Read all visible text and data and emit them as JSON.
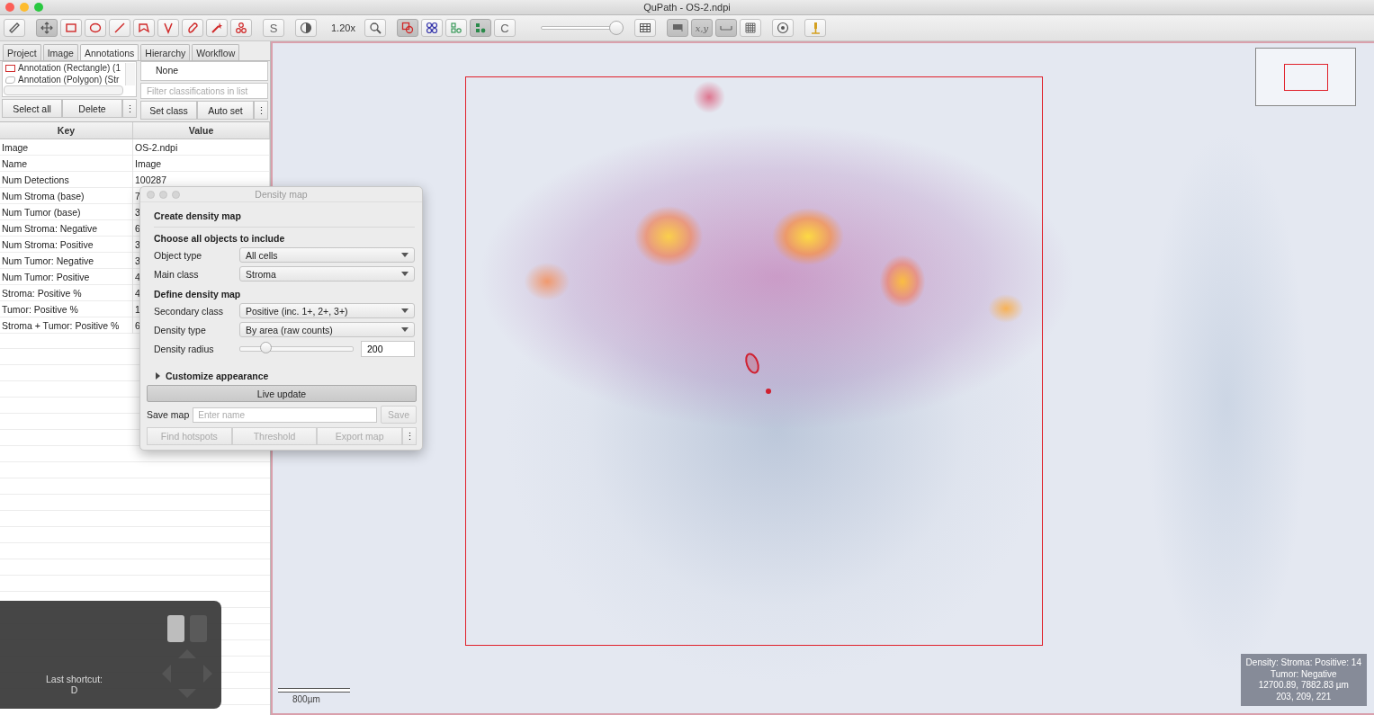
{
  "window": {
    "title": "QuPath - OS-2.ndpi"
  },
  "toolbar": [
    {
      "kind": "icon",
      "selected": false
    },
    {
      "kind": "icon",
      "selected": true
    },
    {
      "kind": "icon",
      "selected": false
    },
    {
      "kind": "icon",
      "selected": false
    },
    {
      "kind": "icon",
      "selected": false
    },
    {
      "kind": "icon",
      "selected": false
    },
    {
      "kind": "icon",
      "selected": false
    },
    {
      "kind": "icon",
      "selected": false
    },
    {
      "kind": "icon",
      "selected": false
    },
    {
      "kind": "icon",
      "selected": false
    },
    {
      "kind": "text",
      "label": "S",
      "selected": false
    },
    {
      "kind": "icon",
      "selected": false
    },
    {
      "kind": "zoom",
      "label": "1.20x"
    },
    {
      "kind": "icon",
      "selected": false
    },
    {
      "kind": "icon",
      "selected": true
    },
    {
      "kind": "icon",
      "selected": false
    },
    {
      "kind": "icon",
      "selected": false
    },
    {
      "kind": "icon",
      "selected": true
    },
    {
      "kind": "text",
      "label": "C",
      "selected": false
    },
    {
      "kind": "slider",
      "level": 0.95
    },
    {
      "kind": "icon",
      "selected": false
    },
    {
      "kind": "icon",
      "selected": true
    },
    {
      "kind": "text",
      "label": "x,y",
      "selected": true
    },
    {
      "kind": "icon",
      "selected": true
    },
    {
      "kind": "icon",
      "selected": false
    },
    {
      "kind": "icon",
      "selected": false
    },
    {
      "kind": "icon",
      "selected": false
    }
  ],
  "tabs": [
    {
      "label": "Project",
      "selected": false
    },
    {
      "label": "Image",
      "selected": false
    },
    {
      "label": "Annotations",
      "selected": true
    },
    {
      "label": "Hierarchy",
      "selected": false
    },
    {
      "label": "Workflow",
      "selected": false
    }
  ],
  "annotations": [
    {
      "label": "Annotation (Rectangle) (1",
      "color": "#d03030"
    },
    {
      "label": "Annotation (Polygon) (Str",
      "color": "#b8b8b8"
    }
  ],
  "classes": [
    {
      "label": "None",
      "selected": false
    }
  ],
  "class_filter": {
    "placeholder": "Filter classifications in list"
  },
  "annotation_buttons": [
    "Select all",
    "Delete",
    "⋮"
  ],
  "class_buttons": [
    "Set class",
    "Auto set",
    "⋮"
  ],
  "measurements": {
    "columns": [
      "Key",
      "Value"
    ],
    "rows": [
      [
        "Image",
        "OS-2.ndpi"
      ],
      [
        "Name",
        "Image"
      ],
      [
        "Num Detections",
        "100287"
      ],
      [
        "Num Stroma (base)",
        "7"
      ],
      [
        "Num Tumor (base)",
        "3"
      ],
      [
        "Num Stroma: Negative",
        "6"
      ],
      [
        "Num Stroma: Positive",
        "3"
      ],
      [
        "Num Tumor: Negative",
        "3"
      ],
      [
        "Num Tumor: Positive",
        "4"
      ],
      [
        "Stroma: Positive %",
        "4"
      ],
      [
        "Tumor: Positive %",
        "1"
      ],
      [
        "Stroma + Tumor: Positive %",
        "6"
      ]
    ]
  },
  "dialog": {
    "title": "Density map",
    "heading": "Create density map",
    "rows": [
      {
        "kind": "section",
        "label": "Choose all objects to include"
      },
      {
        "kind": "dropdown",
        "label": "Object type",
        "value": "All cells"
      },
      {
        "kind": "dropdown",
        "label": "Main class",
        "value": "Stroma"
      },
      {
        "kind": "section",
        "label": "Define density map"
      },
      {
        "kind": "dropdown",
        "label": "Secondary class",
        "value": "Positive (inc. 1+, 2+, 3+)"
      },
      {
        "kind": "dropdown",
        "label": "Density type",
        "value": "By area (raw counts)"
      },
      {
        "kind": "slider",
        "label": "Density radius",
        "level": 0.22,
        "value": "200"
      }
    ],
    "appearance": {
      "label": "Customize appearance",
      "expanded": false
    },
    "live_update": "Live update",
    "save": {
      "label": "Save map",
      "placeholder": "Enter name",
      "button": "Save",
      "disabled": true
    },
    "actions": [
      {
        "label": "Find hotspots",
        "disabled": true
      },
      {
        "label": "Threshold",
        "disabled": true
      },
      {
        "label": "Export map",
        "disabled": true
      }
    ],
    "more": "⋮"
  },
  "viewer": {
    "scale_bar": "800µm",
    "info": [
      "Density: Stroma: Positive: 14",
      "Tumor: Negative",
      "12700.89, 7882.83 µm",
      "203, 209, 221"
    ]
  },
  "shortcut": {
    "label": "Last shortcut:",
    "key": "D"
  }
}
